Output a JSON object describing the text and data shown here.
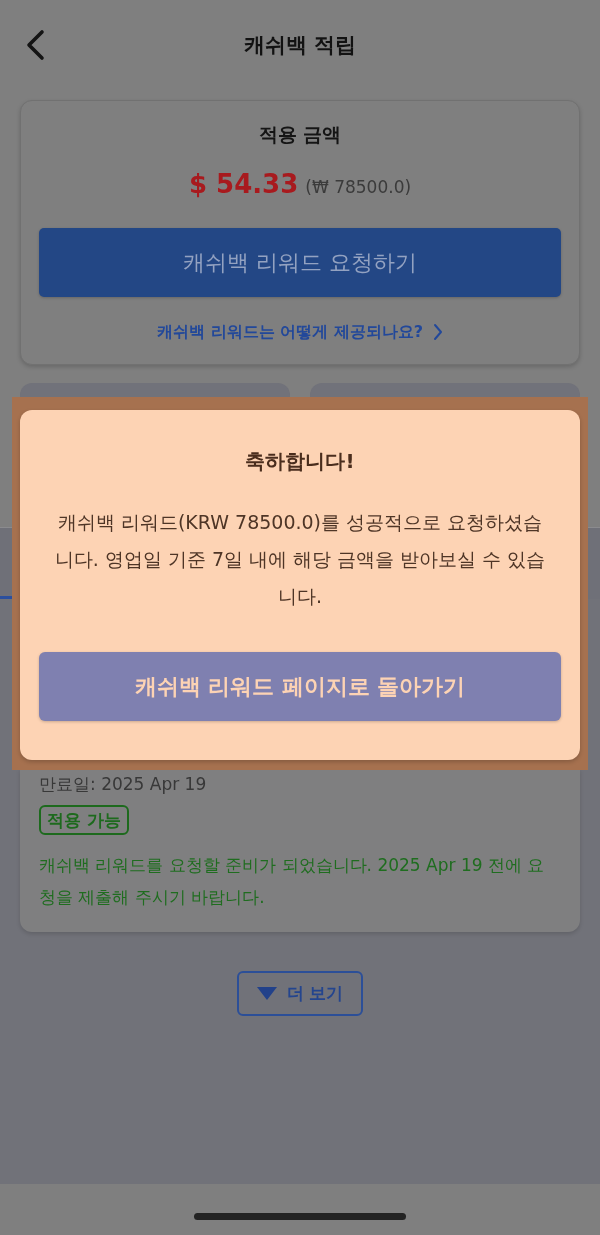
{
  "header": {
    "title": "캐쉬백 적립"
  },
  "amount_card": {
    "label": "적용 금액",
    "amount": "$ 54.33",
    "original_amount": "(₩ 78500.0)",
    "request_button": "캐쉬백 리워드 요청하기",
    "help_link": "캐쉬백 리워드는 어떻게 제공되나요?"
  },
  "reward_card": {
    "expiry": "만료일: 2025 Apr 19",
    "status_badge": "적용 가능",
    "message": "캐쉬백 리워드를 요청할 준비가 되었습니다. 2025 Apr 19 전에 요청을 제출해 주시기 바랍니다."
  },
  "more_button": {
    "label": "더 보기"
  },
  "dialog": {
    "title": "축하합니다!",
    "message": "캐쉬백 리워드(KRW 78500.0)를 성공적으로 요청하셨습니다. 영업일 기준 7일 내에 해당 금액을 받아보실 수 있습니다.",
    "button": "캐쉬백 리워드 페이지로 돌아가기"
  }
}
